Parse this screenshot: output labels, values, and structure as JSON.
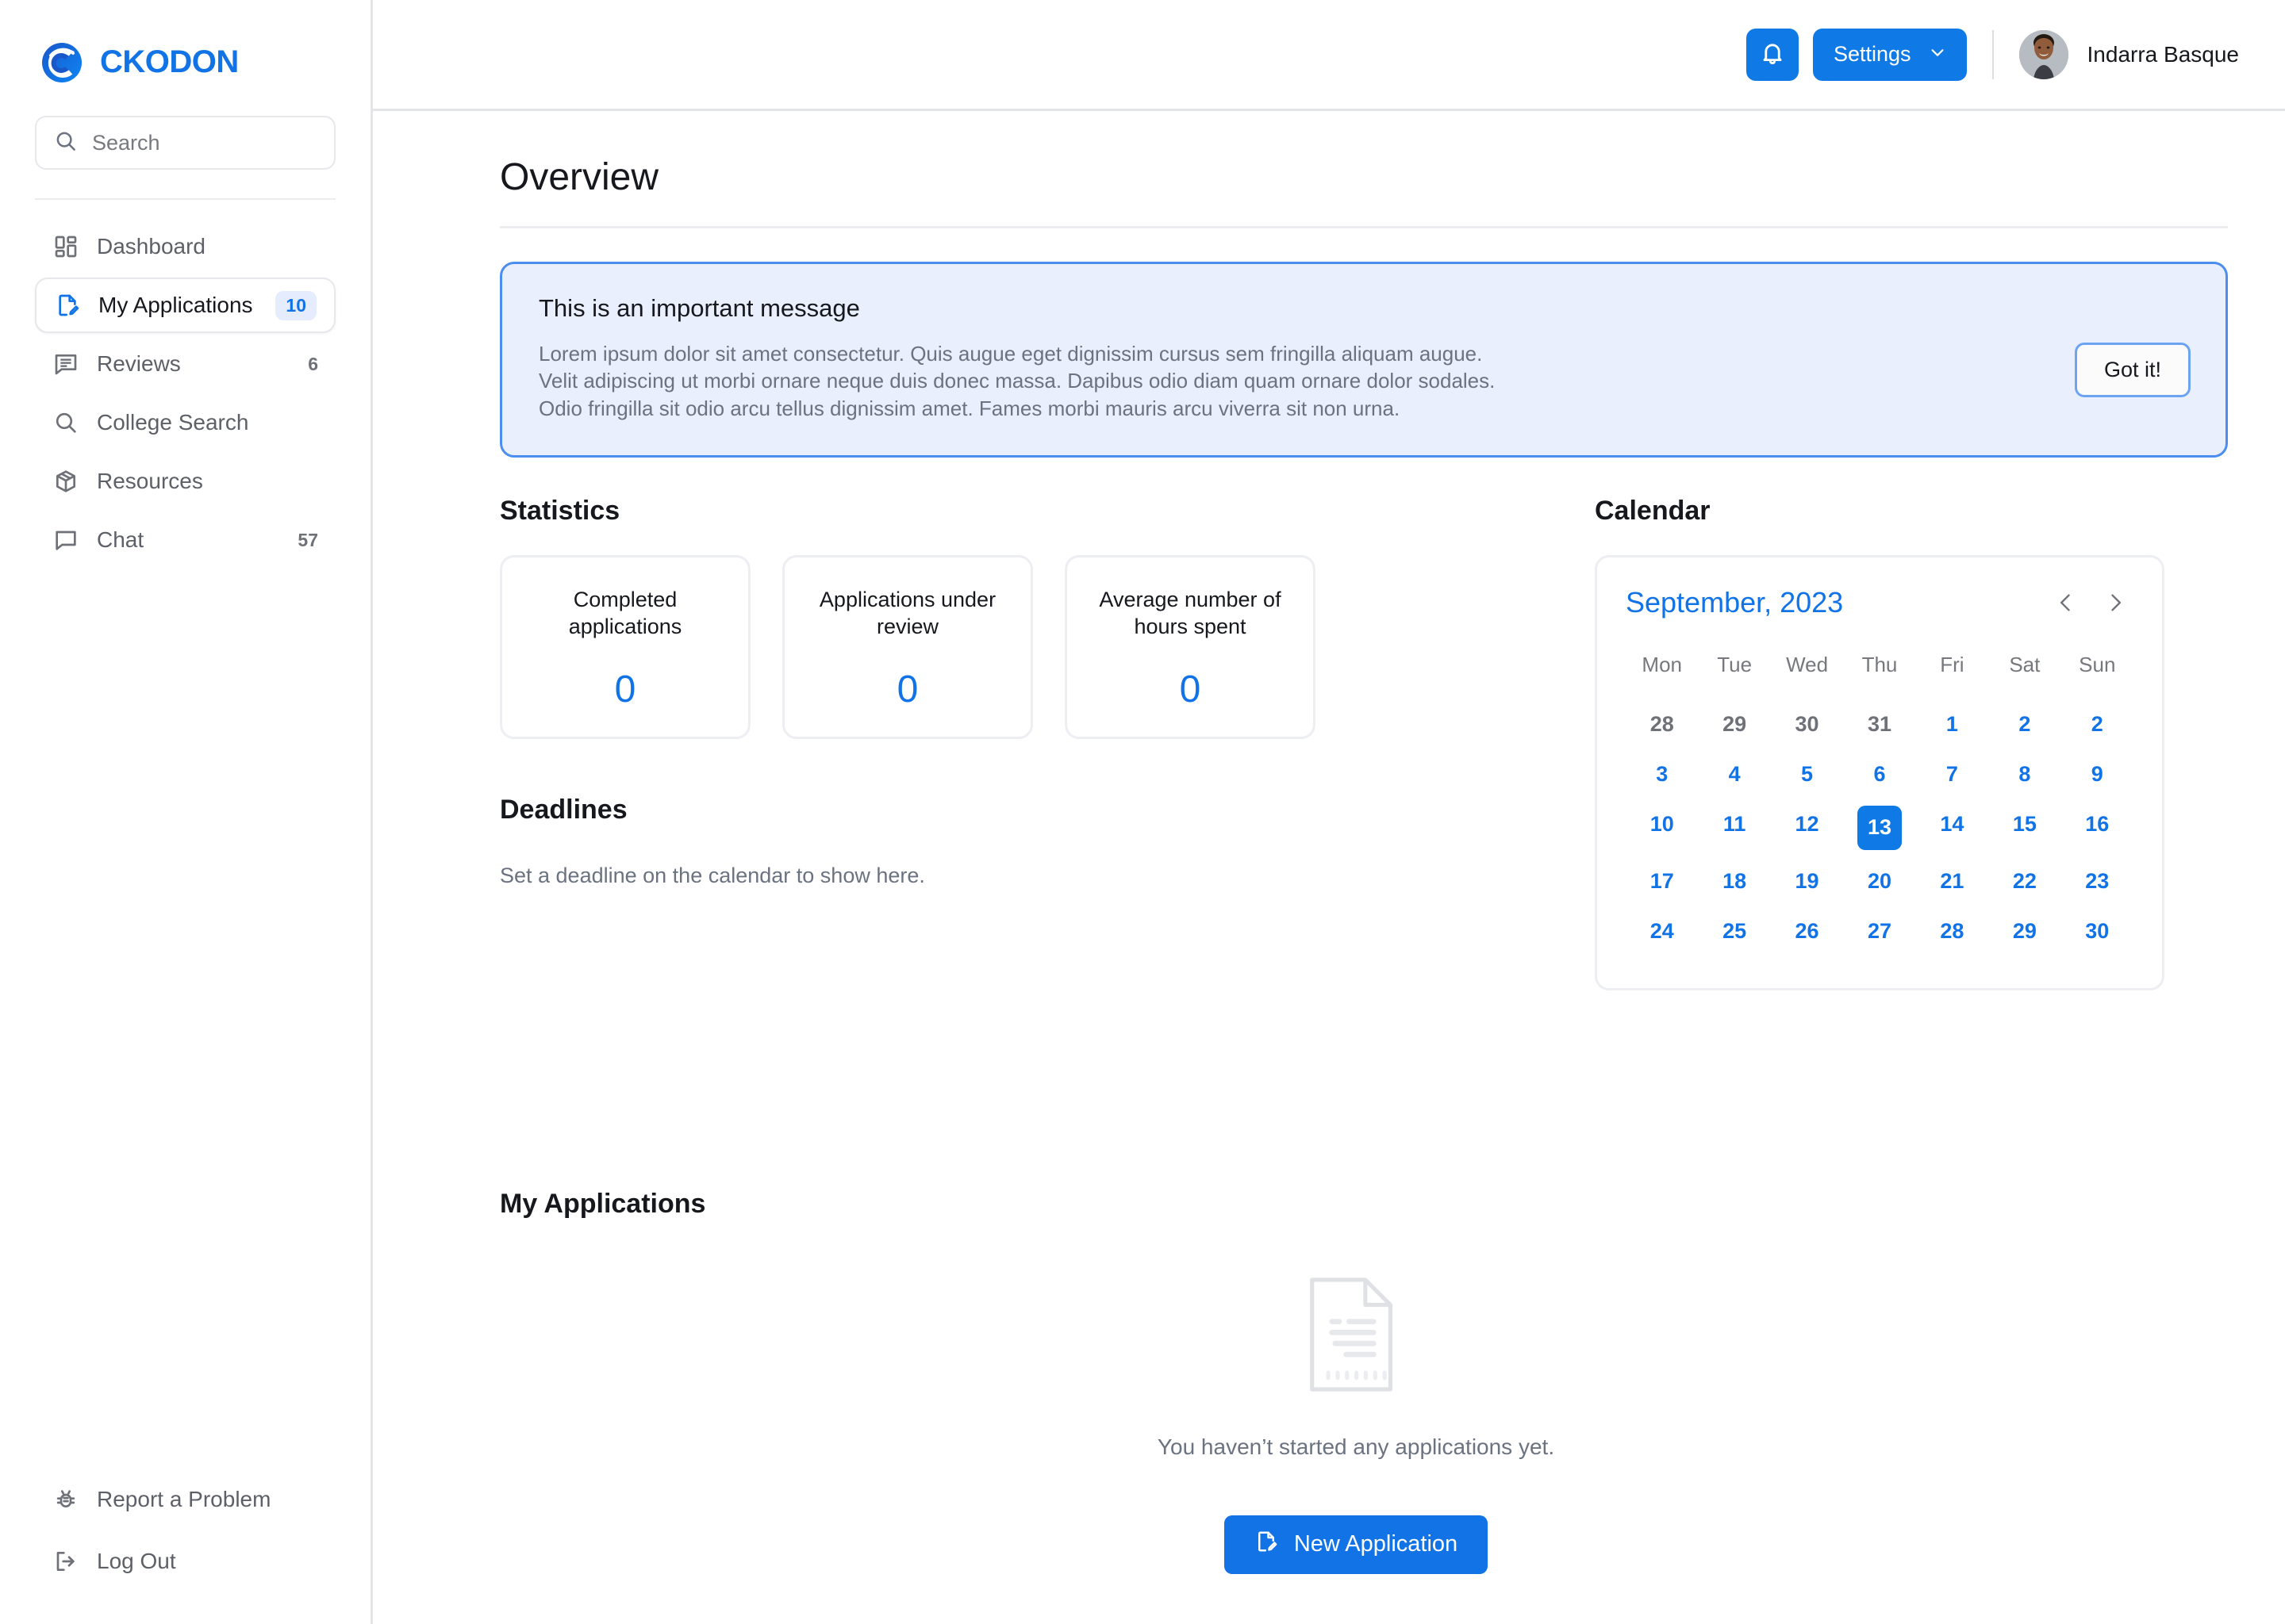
{
  "brand": {
    "name": "CKODON",
    "logo_icon": "ckodon-logo-icon"
  },
  "search": {
    "placeholder": "Search",
    "value": "",
    "icon": "search-icon"
  },
  "sidebar": {
    "items": [
      {
        "label": "Dashboard",
        "icon": "dashboard-grid-icon",
        "count": "",
        "active": false
      },
      {
        "label": "My Applications",
        "icon": "document-edit-icon",
        "count": "10",
        "active": true
      },
      {
        "label": "Reviews",
        "icon": "review-list-icon",
        "count": "6",
        "active": false
      },
      {
        "label": "College Search",
        "icon": "search-icon",
        "count": "",
        "active": false
      },
      {
        "label": "Resources",
        "icon": "box-package-icon",
        "count": "",
        "active": false
      },
      {
        "label": "Chat",
        "icon": "chat-bubble-icon",
        "count": "57",
        "active": false
      }
    ],
    "bottom_items": [
      {
        "label": "Report a Problem",
        "icon": "bug-icon"
      },
      {
        "label": "Log Out",
        "icon": "logout-arrow-icon"
      }
    ]
  },
  "topbar": {
    "bell_icon": "bell-icon",
    "settings_label": "Settings",
    "settings_chevron_icon": "chevron-down-icon",
    "user_name": "Indarra Basque",
    "avatar_icon": "user-avatar"
  },
  "page": {
    "title": "Overview"
  },
  "banner": {
    "title": "This is an important message",
    "line1": "Lorem ipsum dolor sit amet consectetur. Quis augue eget dignissim cursus sem fringilla aliquam augue.",
    "line2": "Velit adipiscing ut morbi ornare neque duis donec massa. Dapibus odio diam quam ornare dolor sodales.",
    "line3": "Odio fringilla sit odio arcu tellus dignissim amet. Fames morbi mauris arcu viverra sit non urna.",
    "dismiss_label": "Got it!"
  },
  "statistics": {
    "heading": "Statistics",
    "cards": [
      {
        "label": "Completed applications",
        "value": "0"
      },
      {
        "label": "Applications under review",
        "value": "0"
      },
      {
        "label": "Average number of hours spent",
        "value": "0"
      }
    ]
  },
  "deadlines": {
    "heading": "Deadlines",
    "empty_text": "Set a deadline on the calendar to show here."
  },
  "calendar": {
    "heading": "Calendar",
    "month_label": "September, 2023",
    "prev_icon": "chevron-left-icon",
    "next_icon": "chevron-right-icon",
    "weekdays": [
      "Mon",
      "Tue",
      "Wed",
      "Thu",
      "Fri",
      "Sat",
      "Sun"
    ],
    "days": [
      {
        "n": "28",
        "muted": true
      },
      {
        "n": "29",
        "muted": true
      },
      {
        "n": "30",
        "muted": true
      },
      {
        "n": "31",
        "muted": true
      },
      {
        "n": "1",
        "muted": false
      },
      {
        "n": "2",
        "muted": false
      },
      {
        "n": "2",
        "muted": false
      },
      {
        "n": "3",
        "muted": false
      },
      {
        "n": "4",
        "muted": false
      },
      {
        "n": "5",
        "muted": false
      },
      {
        "n": "6",
        "muted": false
      },
      {
        "n": "7",
        "muted": false
      },
      {
        "n": "8",
        "muted": false
      },
      {
        "n": "9",
        "muted": false
      },
      {
        "n": "10",
        "muted": false
      },
      {
        "n": "11",
        "muted": false
      },
      {
        "n": "12",
        "muted": false
      },
      {
        "n": "13",
        "muted": false,
        "selected": true
      },
      {
        "n": "14",
        "muted": false
      },
      {
        "n": "15",
        "muted": false
      },
      {
        "n": "16",
        "muted": false
      },
      {
        "n": "17",
        "muted": false
      },
      {
        "n": "18",
        "muted": false
      },
      {
        "n": "19",
        "muted": false
      },
      {
        "n": "20",
        "muted": false
      },
      {
        "n": "21",
        "muted": false
      },
      {
        "n": "22",
        "muted": false
      },
      {
        "n": "23",
        "muted": false
      },
      {
        "n": "24",
        "muted": false
      },
      {
        "n": "25",
        "muted": false
      },
      {
        "n": "26",
        "muted": false
      },
      {
        "n": "27",
        "muted": false
      },
      {
        "n": "28",
        "muted": false
      },
      {
        "n": "29",
        "muted": false
      },
      {
        "n": "30",
        "muted": false
      }
    ],
    "selected_day": "13"
  },
  "my_applications": {
    "heading": "My Applications",
    "empty_icon": "empty-document-icon",
    "empty_text": "You haven’t started any applications yet.",
    "new_button_label": "New Application",
    "new_button_icon": "document-edit-icon"
  },
  "colors": {
    "accent_blue": "#1273e6",
    "button_blue": "#0f7ae5",
    "banner_bg": "#e9effd",
    "banner_border": "#4b8ef0",
    "badge_bg": "#e4ecfd",
    "muted_text": "#6b7280",
    "border": "#e6e8ec"
  }
}
